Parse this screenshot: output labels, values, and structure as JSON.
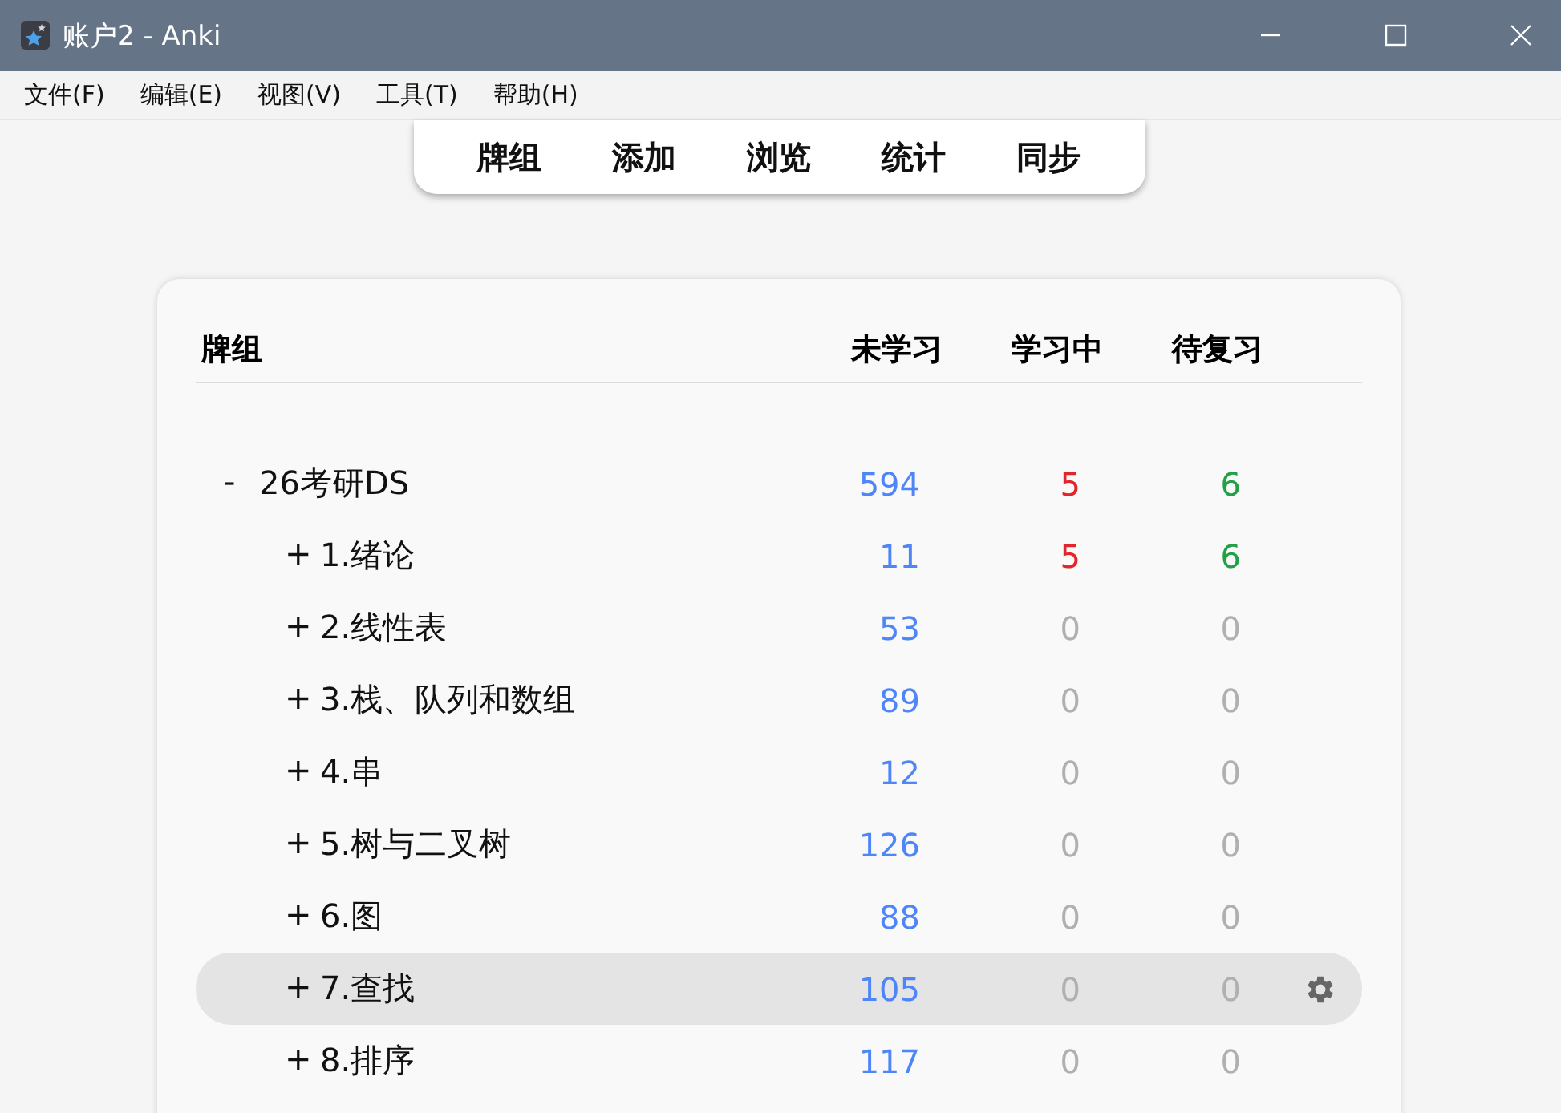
{
  "window": {
    "title": "账户2 - Anki"
  },
  "menu": [
    "文件(F)",
    "编辑(E)",
    "视图(V)",
    "工具(T)",
    "帮助(H)"
  ],
  "toolbar": [
    "牌组",
    "添加",
    "浏览",
    "统计",
    "同步"
  ],
  "table": {
    "columns": [
      "牌组",
      "未学习",
      "学习中",
      "待复习"
    ],
    "rows": [
      {
        "toggle": "-",
        "name": "26考研DS",
        "selected": false,
        "counts": [
          {
            "text": "594",
            "dim": false
          },
          {
            "text": "5",
            "dim": false
          },
          {
            "text": "6",
            "dim": false
          }
        ],
        "children": [
          {
            "toggle": "+",
            "name": "1.绪论",
            "selected": false,
            "counts": [
              {
                "text": "11",
                "dim": false
              },
              {
                "text": "5",
                "dim": false
              },
              {
                "text": "6",
                "dim": false
              }
            ]
          },
          {
            "toggle": "+",
            "name": "2.线性表",
            "selected": false,
            "counts": [
              {
                "text": "53",
                "dim": false
              },
              {
                "text": "0",
                "dim": true
              },
              {
                "text": "0",
                "dim": true
              }
            ]
          },
          {
            "toggle": "+",
            "name": "3.栈、队列和数组",
            "selected": false,
            "counts": [
              {
                "text": "89",
                "dim": false
              },
              {
                "text": "0",
                "dim": true
              },
              {
                "text": "0",
                "dim": true
              }
            ]
          },
          {
            "toggle": "+",
            "name": "4.串",
            "selected": false,
            "counts": [
              {
                "text": "12",
                "dim": false
              },
              {
                "text": "0",
                "dim": true
              },
              {
                "text": "0",
                "dim": true
              }
            ]
          },
          {
            "toggle": "+",
            "name": "5.树与二叉树",
            "selected": false,
            "counts": [
              {
                "text": "126",
                "dim": false
              },
              {
                "text": "0",
                "dim": true
              },
              {
                "text": "0",
                "dim": true
              }
            ]
          },
          {
            "toggle": "+",
            "name": "6.图",
            "selected": false,
            "counts": [
              {
                "text": "88",
                "dim": false
              },
              {
                "text": "0",
                "dim": true
              },
              {
                "text": "0",
                "dim": true
              }
            ]
          },
          {
            "toggle": "+",
            "name": "7.查找",
            "selected": true,
            "counts": [
              {
                "text": "105",
                "dim": false
              },
              {
                "text": "0",
                "dim": true
              },
              {
                "text": "0",
                "dim": true
              }
            ]
          },
          {
            "toggle": "+",
            "name": "8.排序",
            "selected": false,
            "counts": [
              {
                "text": "117",
                "dim": false
              },
              {
                "text": "0",
                "dim": true
              },
              {
                "text": "0",
                "dim": true
              }
            ]
          }
        ]
      }
    ]
  }
}
